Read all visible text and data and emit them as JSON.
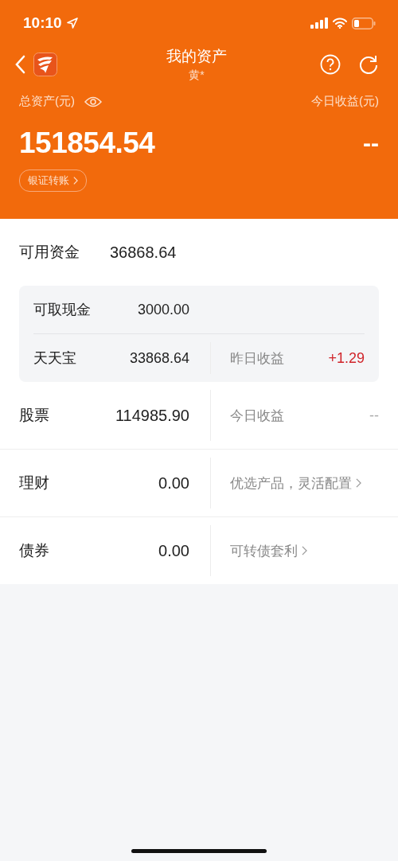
{
  "status_bar": {
    "time": "10:10"
  },
  "header": {
    "title": "我的资产",
    "subtitle": "黄*"
  },
  "summary": {
    "total_label": "总资产(元)",
    "total_value": "151854.54",
    "today_label": "今日收益(元)",
    "today_value": "--",
    "transfer_button": "银证转账"
  },
  "available": {
    "label": "可用资金",
    "value": "36868.64",
    "sub_rows": [
      {
        "label": "可取现金",
        "value": "3000.00"
      },
      {
        "label": "天天宝",
        "value": "33868.64",
        "side": {
          "kind": "stat",
          "label": "昨日收益",
          "value": "+1.29",
          "color": "#d0242a"
        }
      }
    ]
  },
  "assets": [
    {
      "label": "股票",
      "value": "114985.90",
      "side": {
        "kind": "stat",
        "label": "今日收益",
        "value": "--",
        "color": "#aaaaaa"
      }
    },
    {
      "label": "理财",
      "value": "0.00",
      "side": {
        "kind": "link",
        "text": "优选产品，灵活配置"
      }
    },
    {
      "label": "债券",
      "value": "0.00",
      "side": {
        "kind": "link",
        "text": "可转债套利"
      }
    }
  ]
}
